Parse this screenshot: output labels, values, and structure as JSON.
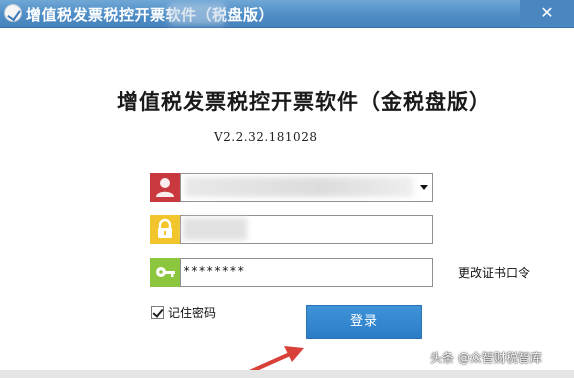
{
  "window": {
    "title": "增值税发票税控开票软件（",
    "title_suffix": "税盘版）",
    "close_glyph": "✕"
  },
  "header": {
    "title": "增值税发票税控开票软件（金税盘版）",
    "version": "V2.2.32.181028"
  },
  "login_form": {
    "user_field": {
      "value": ""
    },
    "lock_field": {
      "value": ""
    },
    "password_field": {
      "value": "********"
    },
    "change_cert_password": "更改证书口令",
    "remember_password": {
      "label": "记住密码",
      "checked": true
    },
    "login_button": "登录"
  },
  "watermark": "头条 @众智财税智库",
  "colors": {
    "titlebar": "#4f8dc6",
    "user_icon_bg": "#c9383e",
    "lock_icon_bg": "#f3c52c",
    "key_icon_bg": "#8cc63e",
    "login_button": "#2b7dc6",
    "arrow": "#d9403a"
  },
  "icons": [
    "app-icon",
    "user-icon",
    "lock-icon",
    "key-icon",
    "dropdown-arrow-icon",
    "checkbox-check-icon",
    "red-arrow-pointer"
  ]
}
